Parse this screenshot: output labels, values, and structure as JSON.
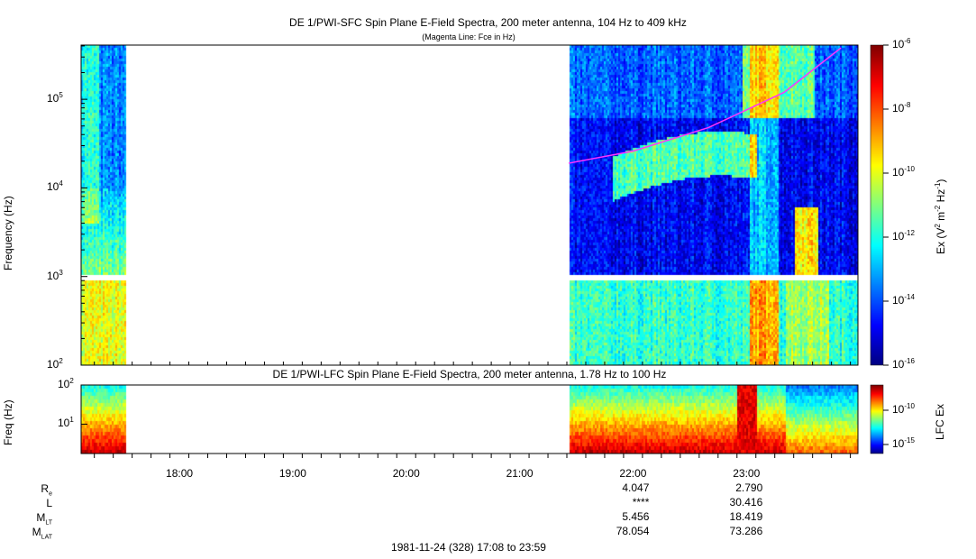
{
  "chart_data": [
    {
      "type": "heatmap",
      "title": "DE 1/PWI-SFC  Spin Plane E-Field Spectra, 200 meter antenna, 104 Hz to 409 kHz",
      "subtitle": "(Magenta Line: Fce in Hz)",
      "ylabel": "Frequency (Hz)",
      "yscale": "log",
      "ylim": [
        100,
        409000
      ],
      "yticks": [
        {
          "v": 100,
          "e": "2"
        },
        {
          "v": 1000,
          "e": "3"
        },
        {
          "v": 10000,
          "e": "4"
        },
        {
          "v": 100000,
          "e": "5"
        }
      ],
      "xlim_minutes": [
        1028,
        1439
      ],
      "data_segments_minutes": [
        [
          1028,
          1051
        ],
        [
          1286,
          1439
        ]
      ],
      "colorbar": {
        "label": "Ex (V",
        "label2": "m",
        "label3": "Hz",
        "label4": ")",
        "exps": [
          "-6",
          "-8",
          "-10",
          "-12",
          "-14",
          "-16"
        ],
        "range_log10": [
          -16,
          -6
        ]
      },
      "fce_line": {
        "color": "#ff33ff",
        "minutes": [
          1286,
          1320,
          1360,
          1400,
          1430
        ],
        "hz": [
          19000,
          26000,
          48000,
          120000,
          380000
        ]
      }
    },
    {
      "type": "heatmap",
      "title": "DE 1/PWI-LFC  Spin Plane E-Field Spectra, 200 meter antenna, 1.78 Hz to 100 Hz",
      "ylabel": "Freq (Hz)",
      "yscale": "log",
      "ylim": [
        1.78,
        100
      ],
      "yticks": [
        {
          "v": 10,
          "e": "1"
        },
        {
          "v": 100,
          "e": "2"
        }
      ],
      "colorbar": {
        "label": "LFC Ex",
        "exps": [
          "-10",
          "-15"
        ],
        "range_log10": [
          -17,
          -7
        ]
      }
    }
  ],
  "xaxis": {
    "ticks": [
      "18:00",
      "19:00",
      "20:00",
      "21:00",
      "22:00",
      "23:00"
    ],
    "tick_minutes": [
      1080,
      1140,
      1200,
      1260,
      1320,
      1380
    ]
  },
  "ephemeris": {
    "labels": [
      {
        "main": "R",
        "sub": "e"
      },
      {
        "main": "L",
        "sub": ""
      },
      {
        "main": "M",
        "sub": "LT"
      },
      {
        "main": "M",
        "sub": "LAT"
      }
    ],
    "col_2200": [
      "4.047",
      "****",
      "5.456",
      "78.054"
    ],
    "col_2300": [
      "2.790",
      "30.416",
      "18.419",
      "73.286"
    ]
  },
  "footer": "1981-11-24 (328) 17:08 to 23:59"
}
